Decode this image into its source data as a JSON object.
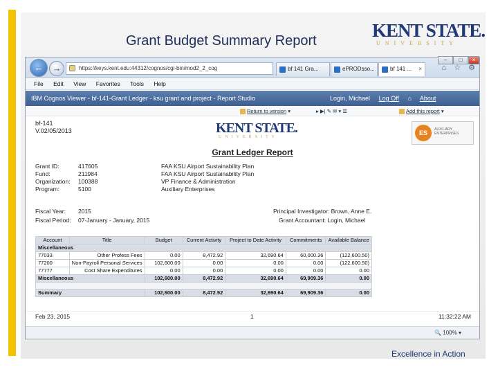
{
  "slide": {
    "title": "Grant Budget Summary Report",
    "logo_word": "KENT STATE.",
    "logo_univ": "UNIVERSITY",
    "tagline": "Excellence in Action",
    "accent_color": "#f2c300"
  },
  "browser": {
    "url": "https://keys.kent.edu:44312/cognos/cgi-bin/mod2_2_cog",
    "url_tools": "⌕ ▾ ☒ ↻ ✕",
    "tabs": [
      {
        "label": "bf 141 Gra..."
      },
      {
        "label": "ePRODsso..."
      },
      {
        "label": "bf 141 ..."
      }
    ],
    "menu": [
      "File",
      "Edit",
      "View",
      "Favorites",
      "Tools",
      "Help"
    ],
    "zoom": "100%"
  },
  "cognos": {
    "title": "IBM Cognos Viewer - bf-141-Grant Ledger - ksu grant and project - Report Studio",
    "user": "Login, Michael",
    "logoff": "Log Off",
    "about": "About",
    "toolbar_return": "Return to version",
    "toolbar_add": "Add this report"
  },
  "report": {
    "id": "bf-141",
    "version": "V.02/05/2013",
    "logo_word": "KENT STATE.",
    "logo_univ": "UNIVERSITY",
    "es_logo_initials": "ES",
    "es_logo_text": "AUXILIARY ENTERPRISES",
    "title": "Grant Ledger Report",
    "info": [
      {
        "label": "Grant ID:",
        "value": "417605",
        "desc": "FAA KSU Airport Sustainability Plan"
      },
      {
        "label": "Fund:",
        "value": "211984",
        "desc": "FAA KSU Airport Sustainability Plan"
      },
      {
        "label": "Organization:",
        "value": "100388",
        "desc": "VP Finance & Administration"
      },
      {
        "label": "Program:",
        "value": "5100",
        "desc": "Auxiliary Enterprises"
      }
    ],
    "fiscal_year_label": "Fiscal Year:",
    "fiscal_year": "2015",
    "fiscal_period_label": "Fiscal Period:",
    "fiscal_period": "07-January - January, 2015",
    "pi_label": "Principal Investigator:",
    "pi": "Brown, Anne E.",
    "ga_label": "Grant Accountant:",
    "ga": "Login, Michael",
    "columns": [
      "Account",
      "Title",
      "Budget",
      "Current Activity",
      "Project to Date Activity",
      "Commitments",
      "Available Balance"
    ],
    "group_label": "Miscellaneous",
    "rows": [
      {
        "account": "77033",
        "title": "Other Profess Fees",
        "budget": "0.00",
        "current": "8,472.92",
        "ptd": "32,690.64",
        "commit": "60,000.36",
        "avail": "(122,600.50)"
      },
      {
        "account": "77200",
        "title": "Non-Payroll Personal Services",
        "budget": "102,600.00",
        "current": "0.00",
        "ptd": "0.00",
        "commit": "0.00",
        "avail": "(122,600.50)"
      },
      {
        "account": "77777",
        "title": "Cost Share Expenditures",
        "budget": "0.00",
        "current": "0.00",
        "ptd": "0.00",
        "commit": "0.00",
        "avail": "0.00"
      }
    ],
    "group_total": {
      "label": "Miscellaneous",
      "budget": "102,600.00",
      "current": "8,472.92",
      "ptd": "32,690.64",
      "commit": "69,909.36",
      "avail": "0.00"
    },
    "summary": {
      "label": "Summary",
      "budget": "102,600.00",
      "current": "8,472.92",
      "ptd": "32,690.64",
      "commit": "69,909.36",
      "avail": "0.00"
    },
    "footer_date": "Feb 23, 2015",
    "footer_page": "1",
    "footer_time": "11:32:22 AM"
  }
}
